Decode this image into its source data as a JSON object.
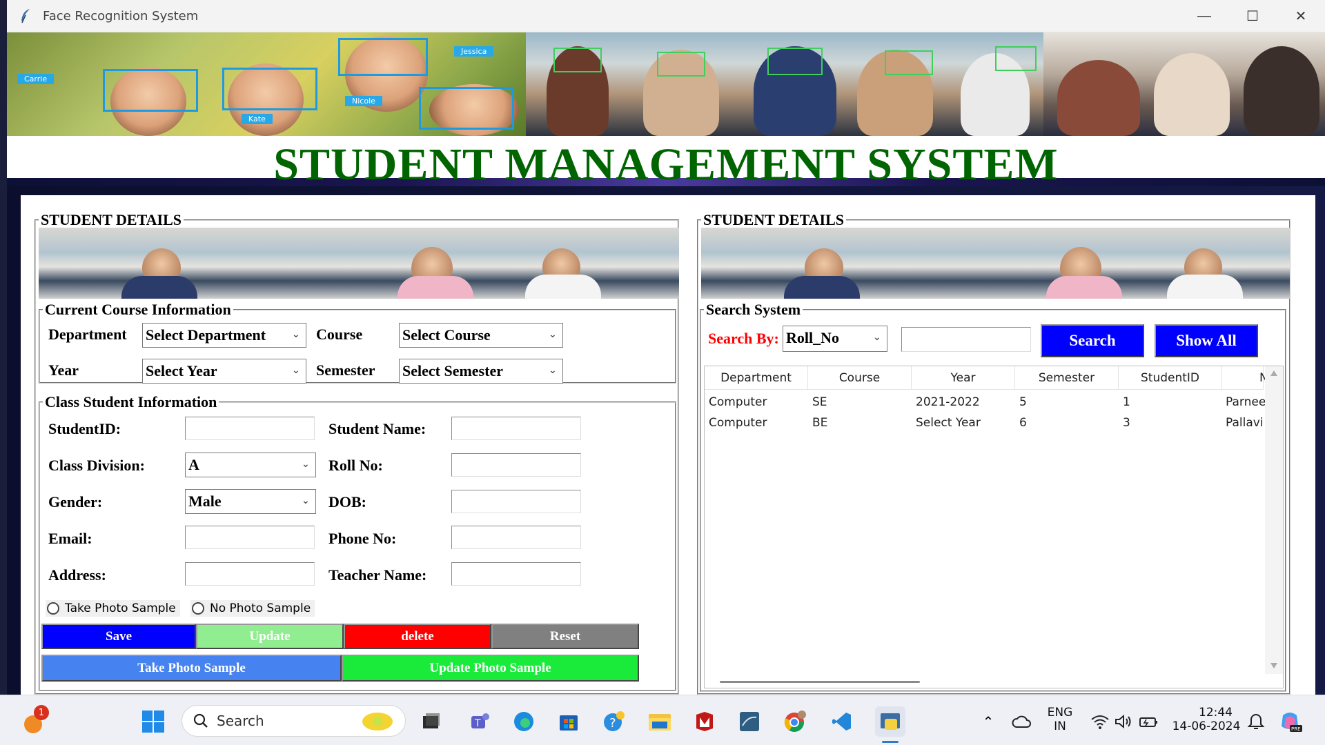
{
  "window": {
    "title": "Face Recognition System",
    "controls": {
      "minimize": "—",
      "maximize": "☐",
      "close": "✕"
    }
  },
  "banner": {
    "face_tags": [
      "Carrie",
      "Kate",
      "Nicole",
      "Jessica"
    ],
    "main_title": "STUDENT MANAGEMENT SYSTEM"
  },
  "left_panel": {
    "frame_title": "STUDENT DETAILS",
    "course_section": {
      "title": "Current Course Information",
      "department_label": "Department",
      "department_value": "Select Department",
      "course_label": "Course",
      "course_value": "Select Course",
      "year_label": "Year",
      "year_value": "Select Year",
      "semester_label": "Semester",
      "semester_value": "Select Semester"
    },
    "class_section": {
      "title": "Class Student Information",
      "student_id_label": "StudentID:",
      "student_name_label": "Student Name:",
      "class_division_label": "Class Division:",
      "class_division_value": "A",
      "roll_no_label": "Roll No:",
      "gender_label": "Gender:",
      "gender_value": "Male",
      "dob_label": "DOB:",
      "email_label": "Email:",
      "phone_label": "Phone No:",
      "address_label": "Address:",
      "teacher_label": "Teacher Name:",
      "radio_take": "Take Photo Sample",
      "radio_no": "No Photo Sample"
    },
    "buttons": {
      "save": "Save",
      "update": "Update",
      "delete": "delete",
      "reset": "Reset",
      "take_photo": "Take Photo Sample",
      "update_photo": "Update Photo Sample"
    }
  },
  "right_panel": {
    "frame_title": "STUDENT DETAILS",
    "search_section": {
      "title": "Search System",
      "search_by_label": "Search By:",
      "search_by_value": "Roll_No",
      "search_button": "Search",
      "show_all_button": "Show All"
    },
    "table": {
      "columns": [
        "Department",
        "Course",
        "Year",
        "Semester",
        "StudentID",
        "N"
      ],
      "rows": [
        [
          "Computer",
          "SE",
          "2021-2022",
          "5",
          "1",
          "Parnee"
        ],
        [
          "Computer",
          "BE",
          "Select Year",
          "6",
          "3",
          "Pallavi"
        ]
      ]
    }
  },
  "colors": {
    "title_green": "#006400",
    "save_blue": "#0000ff",
    "update_lightgreen": "#90ee90",
    "delete_red": "#ff0000",
    "reset_gray": "#808080",
    "take_photo_blue": "#4682f0",
    "update_photo_green": "#1aeb3a",
    "search_by_red": "#ff0000"
  },
  "taskbar": {
    "search_placeholder": "Search",
    "notification_badge": "1",
    "language_top": "ENG",
    "language_bottom": "IN",
    "time": "12:44",
    "date": "14-06-2024"
  }
}
